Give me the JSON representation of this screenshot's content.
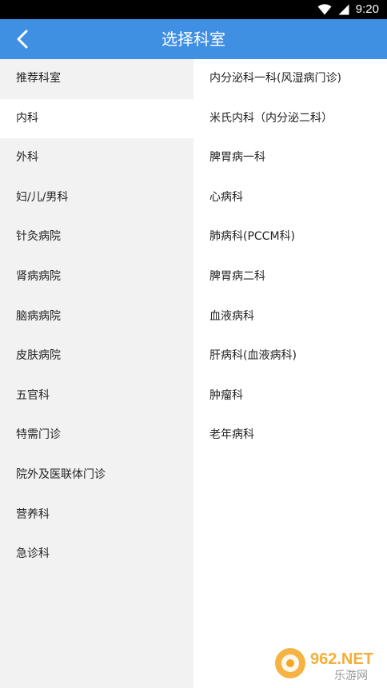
{
  "status_bar": {
    "time": "9:20",
    "icons": [
      "wifi-icon",
      "signal-icon"
    ]
  },
  "header": {
    "title": "选择科室",
    "back_icon": "chevron-left-icon"
  },
  "sidebar": {
    "active_index": 1,
    "items": [
      {
        "label": "推荐科室"
      },
      {
        "label": "内科"
      },
      {
        "label": "外科"
      },
      {
        "label": "妇/儿/男科"
      },
      {
        "label": "针灸病院"
      },
      {
        "label": "肾病病院"
      },
      {
        "label": "脑病病院"
      },
      {
        "label": "皮肤病院"
      },
      {
        "label": "五官科"
      },
      {
        "label": "特需门诊"
      },
      {
        "label": "院外及医联体门诊"
      },
      {
        "label": "营养科"
      },
      {
        "label": "急诊科"
      }
    ]
  },
  "departments": {
    "items": [
      {
        "label": "内分泌科一科(风湿病门诊)"
      },
      {
        "label": "米氏内科（内分泌二科）"
      },
      {
        "label": "脾胃病一科"
      },
      {
        "label": "心病科"
      },
      {
        "label": "肺病科(PCCM科)"
      },
      {
        "label": "脾胃病二科"
      },
      {
        "label": "血液病科"
      },
      {
        "label": "肝病科(血液病科)"
      },
      {
        "label": "肿瘤科"
      },
      {
        "label": "老年病科"
      }
    ]
  },
  "watermark": {
    "brand": "962.NET",
    "subtitle": "乐游网"
  },
  "colors": {
    "app_bar": "#3f8fe3",
    "sidebar_bg": "#f2f2f2",
    "active_bg": "#ffffff",
    "text": "#222222"
  }
}
